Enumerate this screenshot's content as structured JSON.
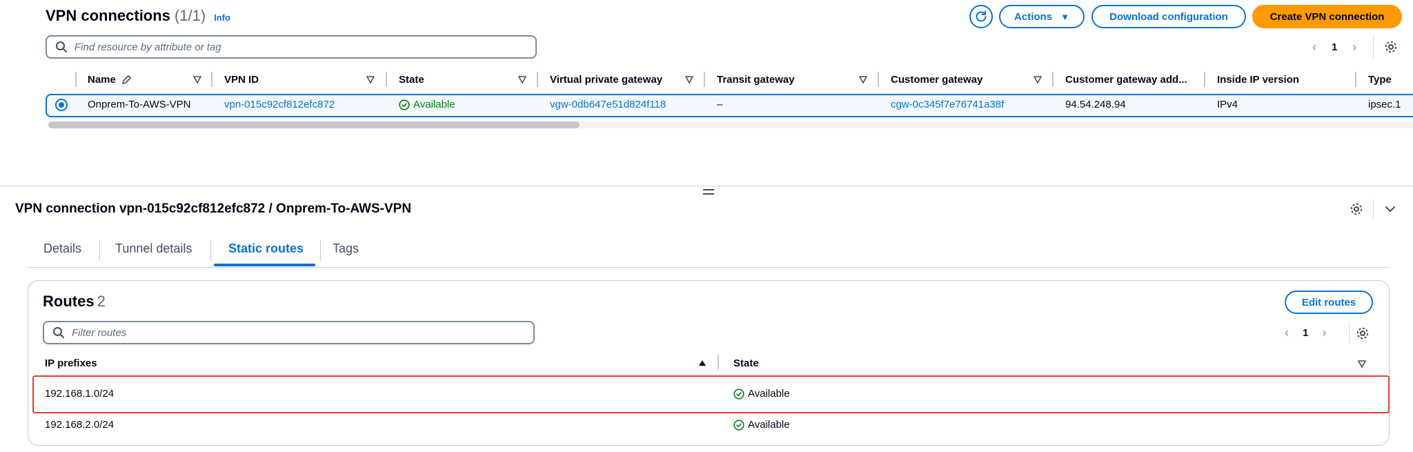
{
  "vpn_list": {
    "title": "VPN connections",
    "count": "(1/1)",
    "info_label": "Info",
    "actions_label": "Actions",
    "download_label": "Download configuration",
    "create_label": "Create VPN connection",
    "search_placeholder": "Find resource by attribute or tag",
    "page": "1",
    "columns": [
      "Name",
      "VPN ID",
      "State",
      "Virtual private gateway",
      "Transit gateway",
      "Customer gateway",
      "Customer gateway add...",
      "Inside IP version",
      "Type"
    ],
    "row": {
      "name": "Onprem-To-AWS-VPN",
      "vpn_id": "vpn-015c92cf812efc872",
      "state": "Available",
      "vgw": "vgw-0db647e51d824f118",
      "tgw": "–",
      "cgw": "cgw-0c345f7e76741a38f",
      "cgw_address": "94.54.248.94",
      "ip_version": "IPv4",
      "type": "ipsec.1"
    }
  },
  "detail": {
    "title": "VPN connection vpn-015c92cf812efc872 / Onprem-To-AWS-VPN",
    "tabs": [
      "Details",
      "Tunnel details",
      "Static routes",
      "Tags"
    ],
    "active_tab": "Static routes"
  },
  "routes": {
    "title": "Routes",
    "count": "2",
    "edit_label": "Edit routes",
    "search_placeholder": "Filter routes",
    "page": "1",
    "columns": [
      "IP prefixes",
      "State"
    ],
    "rows": [
      {
        "prefix": "192.168.1.0/24",
        "state": "Available"
      },
      {
        "prefix": "192.168.2.0/24",
        "state": "Available"
      }
    ]
  },
  "colors": {
    "link": "#0972d3",
    "primary_button": "#ff9900",
    "available": "#037f0c",
    "highlight": "#e0402a"
  },
  "icons": [
    "refresh-icon",
    "caret-down-icon",
    "search-icon",
    "settings-gear-icon",
    "edit-pencil-icon",
    "filter-triangle-icon",
    "check-circle-icon",
    "chevron-left-icon",
    "chevron-right-icon",
    "chevron-down-icon",
    "sort-ascending-icon"
  ]
}
